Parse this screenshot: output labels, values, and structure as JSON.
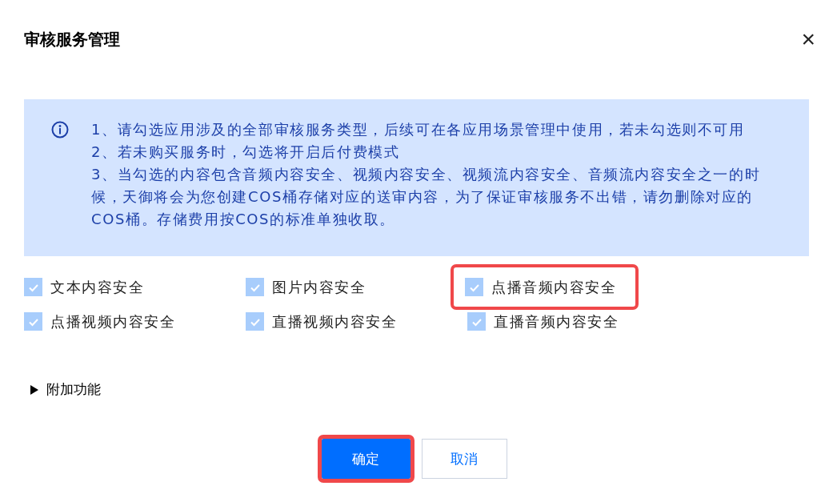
{
  "dialog": {
    "title": "审核服务管理",
    "close": "×"
  },
  "notice": {
    "lines": [
      "1、请勾选应用涉及的全部审核服务类型，后续可在各应用场景管理中使用，若未勾选则不可用",
      "2、若未购买服务时，勾选将开启后付费模式",
      "3、当勾选的内容包含音频内容安全、视频内容安全、视频流内容安全、音频流内容安全之一的时候，天御将会为您创建COS桶存储对应的送审内容，为了保证审核服务不出错，请勿删除对应的COS桶。存储费用按COS的标准单独收取。"
    ]
  },
  "services": [
    {
      "label": "文本内容安全",
      "checked": true,
      "disabled": true,
      "highlighted": false
    },
    {
      "label": "图片内容安全",
      "checked": true,
      "disabled": true,
      "highlighted": false
    },
    {
      "label": "点播音频内容安全",
      "checked": true,
      "disabled": true,
      "highlighted": true
    },
    {
      "label": "点播视频内容安全",
      "checked": true,
      "disabled": true,
      "highlighted": false
    },
    {
      "label": "直播视频内容安全",
      "checked": true,
      "disabled": true,
      "highlighted": false
    },
    {
      "label": "直播音频内容安全",
      "checked": true,
      "disabled": true,
      "highlighted": false
    }
  ],
  "extra": {
    "label": "附加功能",
    "expanded": false
  },
  "buttons": [
    {
      "label": "确定",
      "kind": "primary",
      "highlighted": true
    },
    {
      "label": "取消",
      "kind": "secondary",
      "highlighted": false
    }
  ]
}
